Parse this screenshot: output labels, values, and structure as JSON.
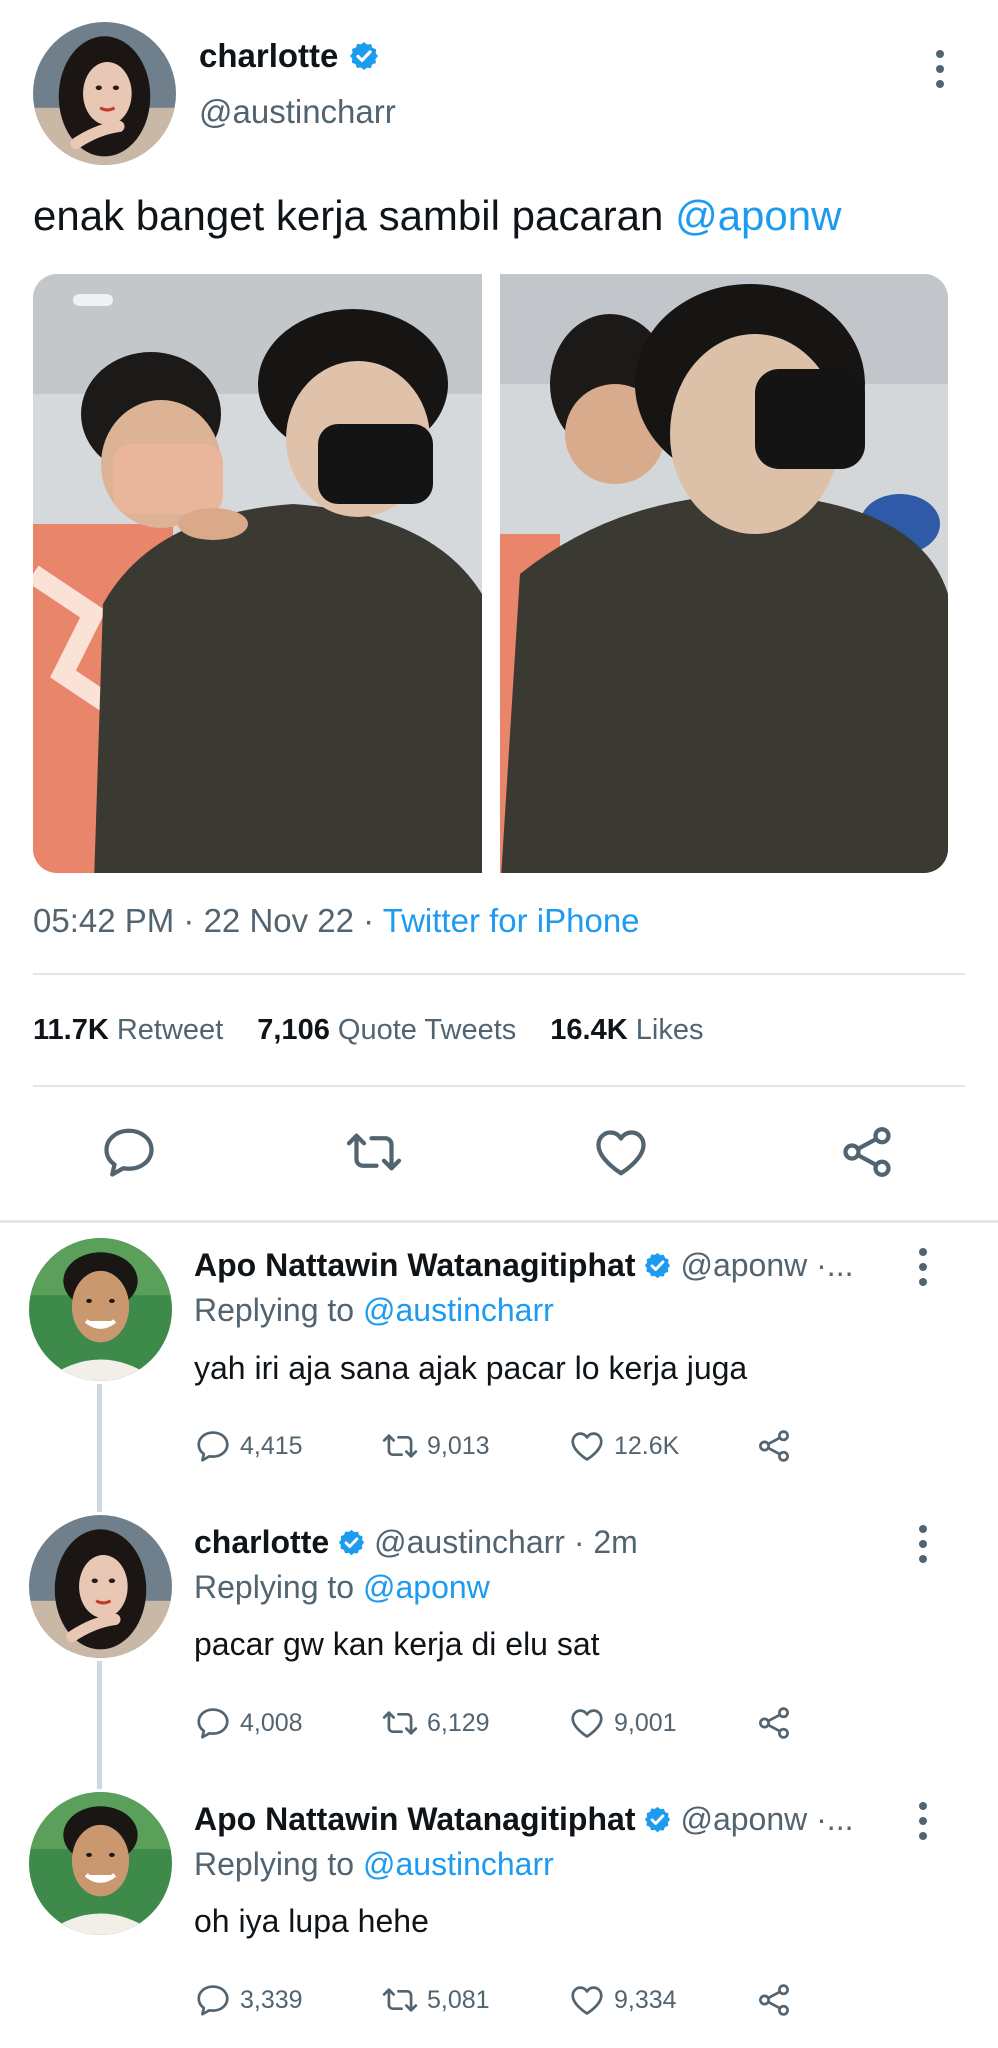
{
  "main_tweet": {
    "name": "charlotte",
    "handle": "@austincharr",
    "text": "enak banget kerja sambil pacaran ",
    "mention": "@aponw",
    "time": "05:42 PM",
    "sep1": " · ",
    "date": "22 Nov 22",
    "sep2": " · ",
    "source": "Twitter for iPhone",
    "stats": {
      "retweets_value": "11.7K",
      "retweets_label": "Retweet",
      "quotes_value": "7,106",
      "quotes_label": "Quote Tweets",
      "likes_value": "16.4K",
      "likes_label": "Likes"
    }
  },
  "replies": [
    {
      "name": "Apo Nattawin Watanagitiphat",
      "handle": "@aponw ·...",
      "replying_prefix": "Replying to ",
      "replying_to": "@austincharr",
      "text": "yah iri aja sana ajak pacar lo kerja juga",
      "comments": "4,415",
      "retweets": "9,013",
      "likes": "12.6K"
    },
    {
      "name": "charlotte",
      "handle": "@austincharr · 2m",
      "replying_prefix": "Replying to ",
      "replying_to": "@aponw",
      "text": "pacar gw kan kerja di elu sat",
      "comments": "4,008",
      "retweets": "6,129",
      "likes": "9,001"
    },
    {
      "name": "Apo Nattawin Watanagitiphat",
      "handle": "@aponw ·...",
      "replying_prefix": "Replying to ",
      "replying_to": "@austincharr",
      "text": "oh iya lupa hehe",
      "comments": "3,339",
      "retweets": "5,081",
      "likes": "9,334"
    }
  ],
  "colors": {
    "accent": "#1d9bf0",
    "text_primary": "#0f1419",
    "text_secondary": "#536471",
    "divider": "#e1e6ea"
  },
  "icons": {
    "verified": "verified-badge-icon",
    "more": "more-options-icon",
    "reply": "comment-icon",
    "retweet": "retweet-icon",
    "like": "heart-icon",
    "share": "share-icon"
  }
}
